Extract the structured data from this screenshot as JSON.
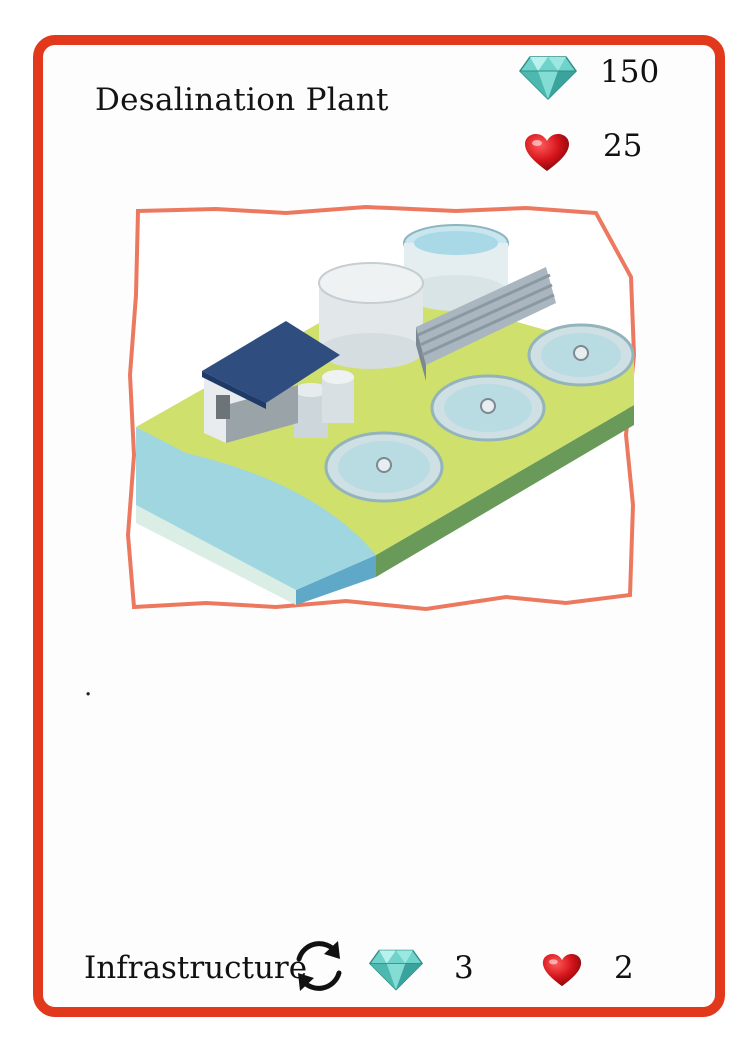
{
  "card": {
    "title": "Desalination Plant",
    "cost": {
      "icon": "gem-icon",
      "value": "150"
    },
    "health": {
      "icon": "heart-icon",
      "value": "25"
    },
    "illustration": "desalination-plant-illustration",
    "description": ".",
    "footer": {
      "category": "Infrastructure",
      "cycle_icon": "cycle-arrows-icon",
      "gem_value": "3",
      "heart_value": "2"
    }
  },
  "colors": {
    "border": "#e2381c",
    "gem": "#5ec9c1",
    "heart": "#d4141a"
  }
}
